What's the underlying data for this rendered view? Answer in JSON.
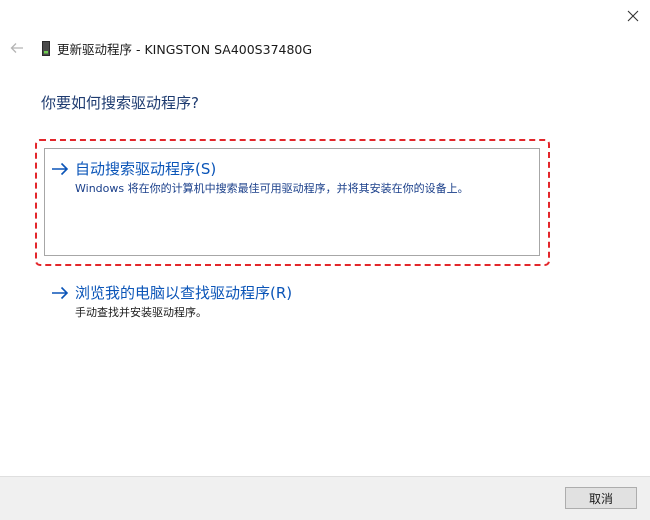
{
  "window": {
    "title": "更新驱动程序 - KINGSTON SA400S37480G"
  },
  "main": {
    "question": "你要如何搜索驱动程序?",
    "options": [
      {
        "label": "自动搜索驱动程序(S)",
        "description": "Windows 将在你的计算机中搜索最佳可用驱动程序，并将其安装在你的设备上。"
      },
      {
        "label": "浏览我的电脑以查找驱动程序(R)",
        "description": "手动查找并安装驱动程序。"
      }
    ]
  },
  "footer": {
    "cancel_label": "取消"
  },
  "colors": {
    "link_blue": "#0b55b8",
    "heading_blue": "#1e3b70",
    "highlight_red": "#e3262b",
    "footer_bg": "#f0f0f0"
  },
  "icons": {
    "close": "close-icon",
    "back": "back-arrow-icon",
    "device": "drive-icon",
    "option": "right-arrow-icon"
  }
}
